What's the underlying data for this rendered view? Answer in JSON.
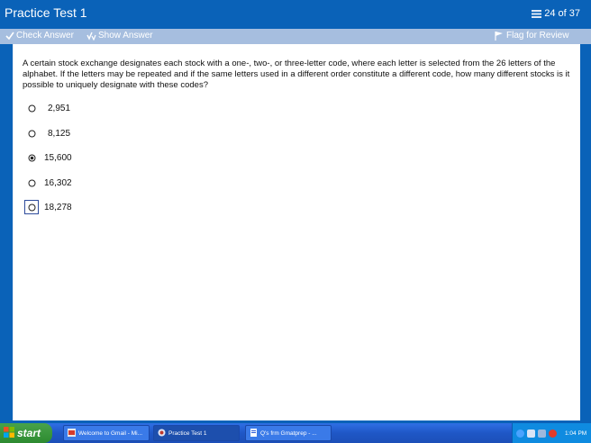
{
  "window": {
    "title": "Practice Test 1",
    "progress": "24 of 37"
  },
  "toolbar": {
    "check_answer": "Check Answer",
    "show_answer": "Show Answer",
    "flag_for_review": "Flag for Review"
  },
  "question": {
    "text": "A certain stock exchange designates each stock with a one-, two-, or three-letter code, where each letter is selected from the 26 letters of the alphabet.  If the letters may be repeated and if the same letters used in a different order constitute a different code, how many different stocks is it possible to uniquely designate with these codes?",
    "choices": [
      {
        "label": "2,951",
        "selected": false,
        "focused": false
      },
      {
        "label": "8,125",
        "selected": false,
        "focused": false
      },
      {
        "label": "15,600",
        "selected": true,
        "focused": false
      },
      {
        "label": "16,302",
        "selected": false,
        "focused": false
      },
      {
        "label": "18,278",
        "selected": false,
        "focused": true
      }
    ]
  },
  "taskbar": {
    "start": "start",
    "tasks": [
      {
        "label": "Welcome to Gmail - Mi..."
      },
      {
        "label": "Practice Test 1"
      },
      {
        "label": "Q's frm Gmatprep - ..."
      }
    ],
    "clock": "1:04 PM"
  }
}
